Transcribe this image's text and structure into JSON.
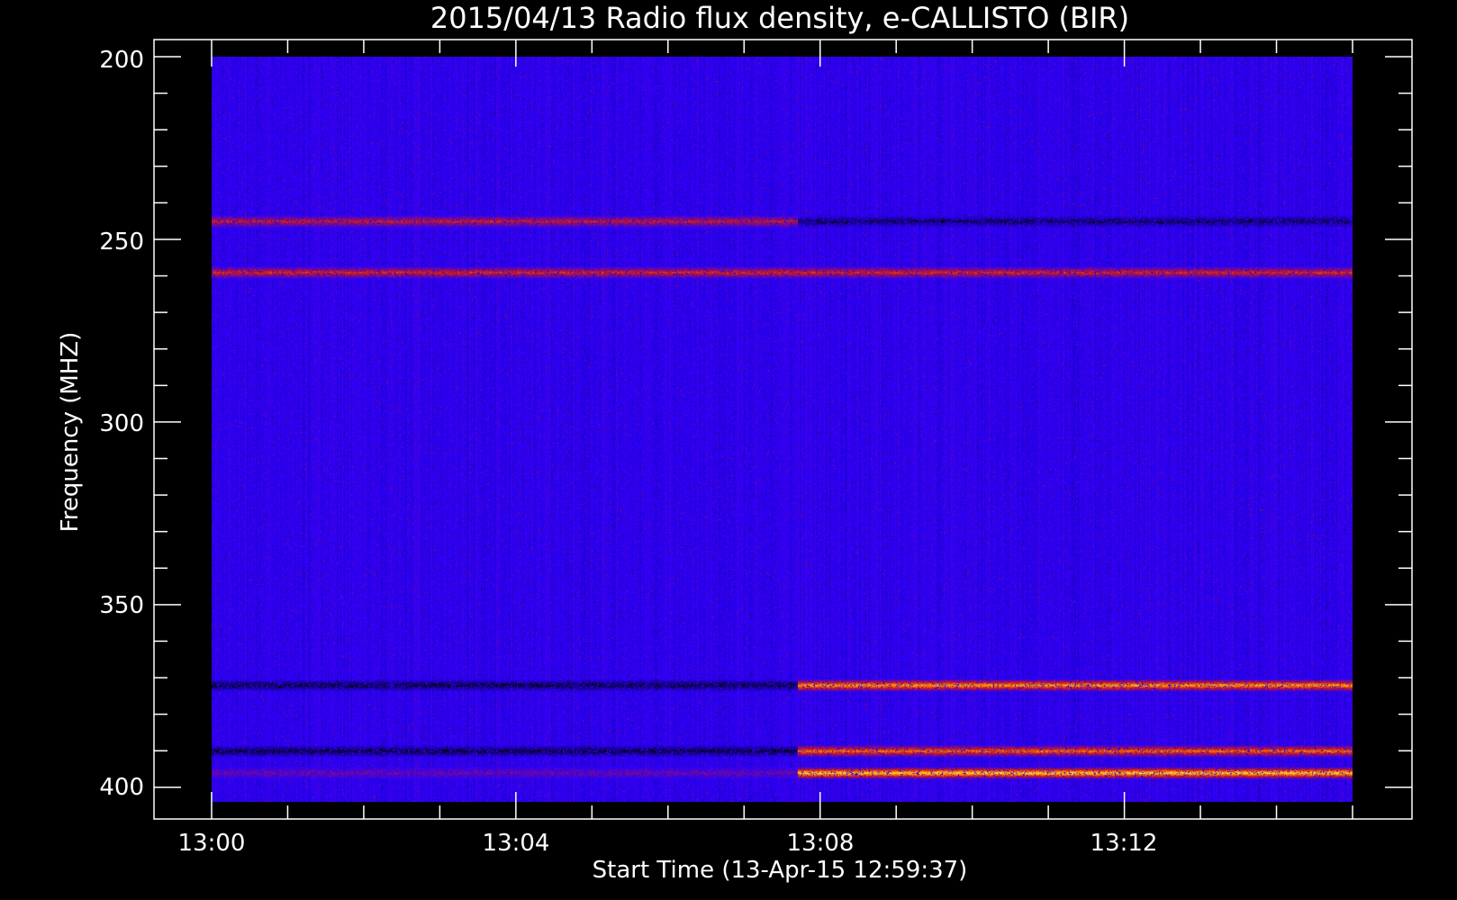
{
  "chart_data": {
    "type": "heatmap",
    "title": "2015/04/13  Radio flux density, e-CALLISTO (BIR)",
    "xlabel": "Start Time (13-Apr-15 12:59:37)",
    "ylabel": "Frequency (MHZ)",
    "x_ticks": [
      "13:00",
      "13:04",
      "13:08",
      "13:12"
    ],
    "y_ticks": [
      "200",
      "250",
      "300",
      "350",
      "400"
    ],
    "y_tick_values": [
      200,
      250,
      300,
      350,
      400
    ],
    "ylim": [
      200,
      404
    ],
    "y_inverted": true,
    "xlim_minutes_after_1300": [
      0,
      15
    ],
    "grid": false,
    "colorscale": [
      "#000000",
      "#2a00ff",
      "#c8141e",
      "#ff7a00",
      "#ffe84a"
    ],
    "background_color": "#2a00ff",
    "features": [
      {
        "freq_mhz": 245,
        "t_start": 0.0,
        "t_end": 7.7,
        "level": 0.55
      },
      {
        "freq_mhz": 245,
        "t_start": 7.7,
        "t_end": 15.0,
        "level": 0.08
      },
      {
        "freq_mhz": 259,
        "t_start": 0.0,
        "t_end": 15.0,
        "level": 0.6
      },
      {
        "freq_mhz": 372,
        "t_start": 0.0,
        "t_end": 7.7,
        "level": 0.05
      },
      {
        "freq_mhz": 372,
        "t_start": 7.7,
        "t_end": 15.0,
        "level": 0.85
      },
      {
        "freq_mhz": 390,
        "t_start": 0.0,
        "t_end": 7.7,
        "level": 0.05
      },
      {
        "freq_mhz": 390,
        "t_start": 7.7,
        "t_end": 15.0,
        "level": 0.75
      },
      {
        "freq_mhz": 396,
        "t_start": 0.0,
        "t_end": 7.7,
        "level": 0.35
      },
      {
        "freq_mhz": 396,
        "t_start": 7.7,
        "t_end": 15.0,
        "level": 0.95
      }
    ]
  }
}
